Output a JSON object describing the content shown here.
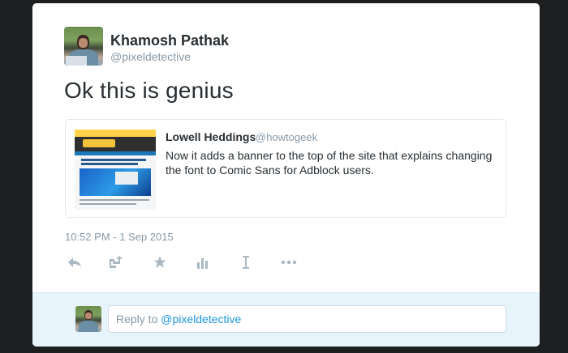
{
  "author": {
    "name": "Khamosh Pathak",
    "handle": "@pixeldetective"
  },
  "tweet": {
    "text": "Ok this is genius",
    "timestamp": "10:52 PM - 1 Sep 2015"
  },
  "quoted_tweet": {
    "name": "Lowell Heddings",
    "handle": "@howtogeek",
    "text": "Now it adds a banner to the top of the site that explains changing the font to Comic Sans for Adblock users."
  },
  "actions": [
    {
      "name": "reply-icon",
      "glyph": "↰"
    },
    {
      "name": "retweet-icon",
      "glyph": "⇄"
    },
    {
      "name": "favorite-star-icon",
      "glyph": "★"
    },
    {
      "name": "analytics-icon",
      "glyph": "▮"
    },
    {
      "name": "text-cursor-icon",
      "glyph": "I"
    },
    {
      "name": "more-dots-icon",
      "glyph": "•••"
    }
  ],
  "reply_box": {
    "prefix": "Reply to ",
    "mention": "@pixeldetective"
  },
  "colors": {
    "page_bg": "#1e1f21",
    "card_bg": "#ffffff",
    "reply_bg": "#e8f4fb",
    "link": "#1b95e0",
    "muted": "#8899a6",
    "icon": "#aab8c2"
  }
}
